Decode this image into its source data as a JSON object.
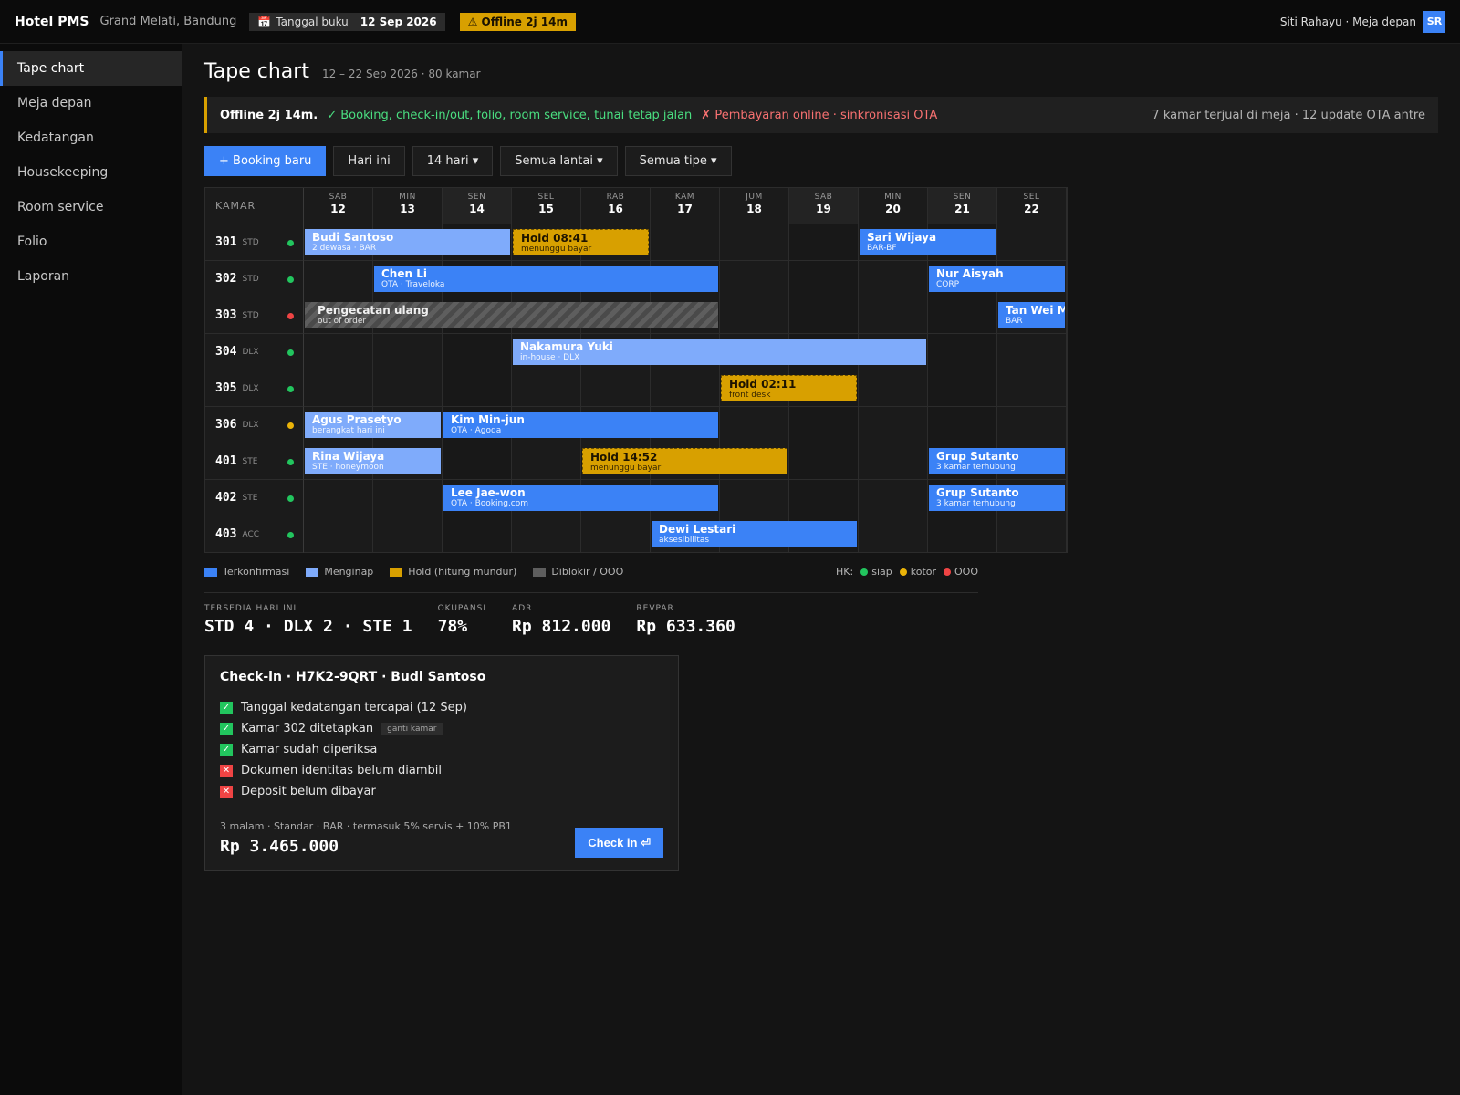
{
  "topbar": {
    "brand": "Hotel PMS",
    "hotel": "Grand Melati, Bandung",
    "book_label": "Tanggal buku",
    "book_date": "12 Sep 2026",
    "offline_chip": "⚠ Offline 2j 14m",
    "user": "Siti Rahayu · Meja depan",
    "avatar": "SR"
  },
  "sidebar": {
    "items": [
      {
        "label": "Tape chart",
        "active": true
      },
      {
        "label": "Meja depan"
      },
      {
        "label": "Kedatangan"
      },
      {
        "label": "Housekeeping"
      },
      {
        "label": "Room service"
      },
      {
        "label": "Folio"
      },
      {
        "label": "Laporan"
      }
    ]
  },
  "header": {
    "title": "Tape chart",
    "subtitle": "12 – 22 Sep 2026 · 80 kamar"
  },
  "banner": {
    "title": "Offline 2j 14m.",
    "ok": "✓ Booking, check-in/out, folio, room service, tunai tetap jalan",
    "bad": "✗ Pembayaran online · sinkronisasi OTA",
    "right": "7 kamar terjual di meja · 12 update OTA antre"
  },
  "toolbar": {
    "new_booking": "+ Booking baru",
    "today": "Hari ini",
    "range": "14 hari ▾",
    "floors": "Semua lantai ▾",
    "types": "Semua tipe ▾"
  },
  "chart": {
    "corner_label": "KAMAR",
    "days": [
      {
        "dow": "SAB",
        "num": "12",
        "weekend": false
      },
      {
        "dow": "MIN",
        "num": "13",
        "weekend": false
      },
      {
        "dow": "SEN",
        "num": "14",
        "weekend": true
      },
      {
        "dow": "SEL",
        "num": "15",
        "weekend": false
      },
      {
        "dow": "RAB",
        "num": "16",
        "weekend": false
      },
      {
        "dow": "KAM",
        "num": "17",
        "weekend": false
      },
      {
        "dow": "JUM",
        "num": "18",
        "weekend": false
      },
      {
        "dow": "SAB",
        "num": "19",
        "weekend": true
      },
      {
        "dow": "MIN",
        "num": "20",
        "weekend": false
      },
      {
        "dow": "SEN",
        "num": "21",
        "weekend": true
      },
      {
        "dow": "SEL",
        "num": "22",
        "weekend": false
      }
    ],
    "rooms": [
      {
        "num": "301",
        "type": "STD",
        "hk": "siap"
      },
      {
        "num": "302",
        "type": "STD",
        "hk": "siap"
      },
      {
        "num": "303",
        "type": "STD",
        "hk": "ooo"
      },
      {
        "num": "304",
        "type": "DLX",
        "hk": "siap"
      },
      {
        "num": "305",
        "type": "DLX",
        "hk": "siap"
      },
      {
        "num": "306",
        "type": "DLX",
        "hk": "kotor"
      },
      {
        "num": "401",
        "type": "STE",
        "hk": "siap"
      },
      {
        "num": "402",
        "type": "STE",
        "hk": "siap"
      },
      {
        "num": "403",
        "type": "ACC",
        "hk": "siap"
      }
    ],
    "bookings": [
      {
        "row": 0,
        "start": 0,
        "nights": 3,
        "kind": "inhouse",
        "name": "Budi Santoso",
        "sub": "2 dewasa · BAR"
      },
      {
        "row": 0,
        "start": 3,
        "nights": 2,
        "kind": "hold",
        "name": "Hold 08:41",
        "sub": "menunggu bayar"
      },
      {
        "row": 0,
        "start": 8,
        "nights": 2,
        "kind": "confirmed",
        "name": "Sari Wijaya",
        "sub": "BAR-BF"
      },
      {
        "row": 1,
        "start": 1,
        "nights": 5,
        "kind": "confirmed",
        "name": "Chen Li",
        "sub": "OTA · Traveloka"
      },
      {
        "row": 1,
        "start": 9,
        "nights": 2,
        "kind": "confirmed",
        "name": "Nur Aisyah",
        "sub": "CORP"
      },
      {
        "row": 2,
        "start": 0,
        "nights": 6,
        "kind": "blocked",
        "name": "Pengecatan ulang",
        "sub": "out of order"
      },
      {
        "row": 2,
        "start": 10,
        "nights": 1,
        "kind": "confirmed",
        "name": "Tan Wei Ming",
        "sub": "BAR"
      },
      {
        "row": 3,
        "start": 3,
        "nights": 6,
        "kind": "inhouse",
        "name": "Nakamura Yuki",
        "sub": "in-house · DLX"
      },
      {
        "row": 4,
        "start": 6,
        "nights": 2,
        "kind": "hold",
        "name": "Hold 02:11",
        "sub": "front desk"
      },
      {
        "row": 5,
        "start": 0,
        "nights": 2,
        "kind": "inhouse",
        "name": "Agus Prasetyo",
        "sub": "berangkat hari ini"
      },
      {
        "row": 5,
        "start": 2,
        "nights": 4,
        "kind": "confirmed",
        "name": "Kim Min-jun",
        "sub": "OTA · Agoda"
      },
      {
        "row": 6,
        "start": 0,
        "nights": 2,
        "kind": "inhouse",
        "name": "Rina Wijaya",
        "sub": "STE · honeymoon"
      },
      {
        "row": 6,
        "start": 4,
        "nights": 3,
        "kind": "hold",
        "name": "Hold 14:52",
        "sub": "menunggu bayar"
      },
      {
        "row": 6,
        "start": 9,
        "nights": 2,
        "kind": "confirmed",
        "name": "Grup Sutanto",
        "sub": "3 kamar terhubung"
      },
      {
        "row": 7,
        "start": 2,
        "nights": 4,
        "kind": "confirmed",
        "name": "Lee Jae-won",
        "sub": "OTA · Booking.com"
      },
      {
        "row": 7,
        "start": 9,
        "nights": 2,
        "kind": "confirmed",
        "name": "Grup Sutanto",
        "sub": "3 kamar terhubung"
      },
      {
        "row": 8,
        "start": 5,
        "nights": 3,
        "kind": "confirmed",
        "name": "Dewi Lestari",
        "sub": "aksesibilitas"
      }
    ]
  },
  "legend": {
    "confirmed": "Terkonfirmasi",
    "inhouse": "Menginap",
    "hold": "Hold (hitung mundur)",
    "blocked": "Diblokir / OOO",
    "hk_label": "HK:",
    "hk_ready": "siap",
    "hk_dirty": "kotor",
    "hk_ooo": "OOO"
  },
  "stats": [
    {
      "label": "TERSEDIA HARI INI",
      "value": "STD 4 · DLX 2 · STE 1"
    },
    {
      "label": "OKUPANSI",
      "value": "78%"
    },
    {
      "label": "ADR",
      "value": "Rp 812.000"
    },
    {
      "label": "REVPAR",
      "value": "Rp 633.360"
    }
  ],
  "checkin": {
    "title": "Check-in · H7K2-9QRT · Budi Santoso",
    "items": [
      {
        "ok": true,
        "label": "Tanggal kedatangan tercapai (12 Sep)"
      },
      {
        "ok": true,
        "label": "Kamar 302 ditetapkan",
        "chip": "ganti kamar"
      },
      {
        "ok": true,
        "label": "Kamar sudah diperiksa"
      },
      {
        "ok": false,
        "label": "Dokumen identitas belum diambil"
      },
      {
        "ok": false,
        "label": "Deposit belum dibayar"
      }
    ],
    "summary": "3 malam · Standar · BAR · termasuk 5% servis + 10% PB1",
    "total": "Rp 3.465.000",
    "button": "Check in ⏎"
  },
  "colors": {
    "confirmed": "#3b82f6",
    "inhouse": "#7fabfb",
    "hold": "#d8a000",
    "blocked": "#5e5e5e",
    "hk_siap": "#22c55e",
    "hk_kotor": "#eab308",
    "hk_ooo": "#ef4444"
  }
}
